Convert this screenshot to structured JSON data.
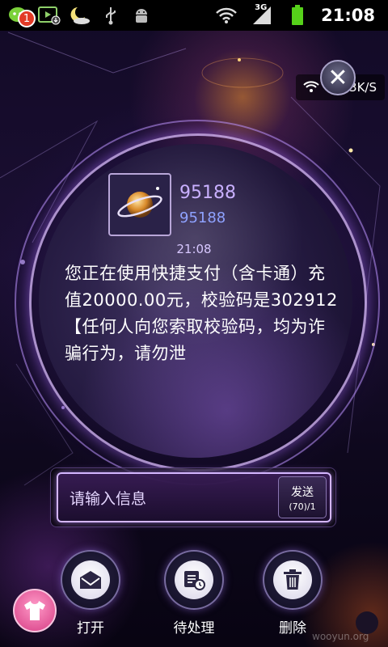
{
  "status_bar": {
    "notification_count": "1",
    "network_type": "3G",
    "time": "21:08"
  },
  "speed_widget": {
    "speed": "3K/S",
    "close_glyph": "✕"
  },
  "message": {
    "sender_name": "95188",
    "sender_number": "95188",
    "time": "21:08",
    "body": "您正在使用快捷支付（含卡通）充值20000.00元，校验码是302912【任何人向您索取校验码，均为诈骗行为，请勿泄"
  },
  "compose": {
    "placeholder": "请输入信息",
    "send_label": "发送",
    "char_count": "(70)/1"
  },
  "actions": {
    "open_label": "打开",
    "pending_label": "待处理",
    "delete_label": "删除"
  },
  "watermark": "wooyun.org",
  "colors": {
    "accent_purple": "#c9b0ff",
    "number_blue": "#8fa2ff",
    "battery_green": "#56d11a",
    "badge_red": "#e23a26"
  }
}
